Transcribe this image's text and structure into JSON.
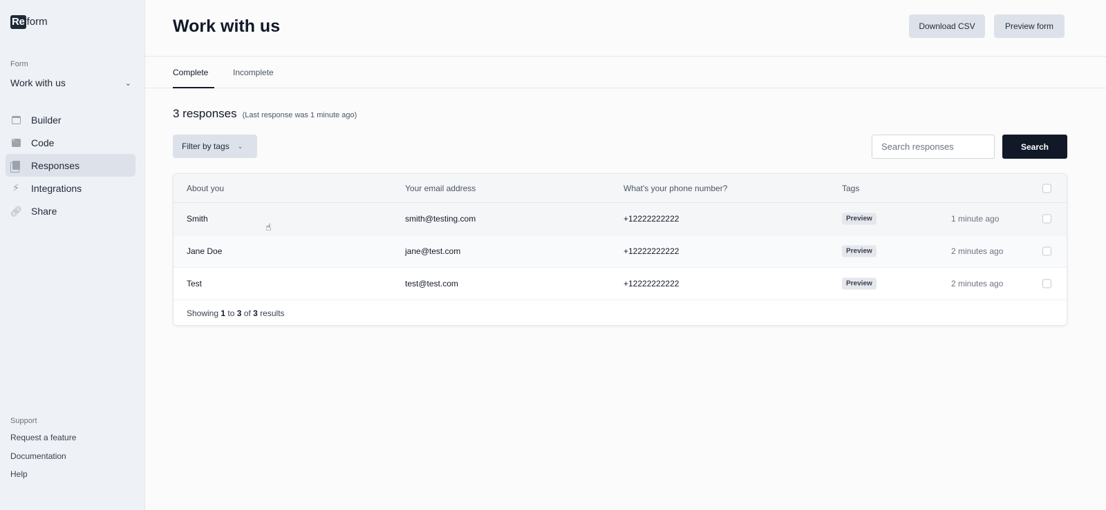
{
  "sidebar": {
    "logo_box": "Re",
    "logo_rest": "form",
    "form_label": "Form",
    "form_value": "Work with us",
    "nav": [
      {
        "label": "Builder",
        "icon": "calendar-icon"
      },
      {
        "label": "Code",
        "icon": "terminal-icon"
      },
      {
        "label": "Responses",
        "icon": "documents-icon",
        "active": true
      },
      {
        "label": "Integrations",
        "icon": "bolt-icon"
      },
      {
        "label": "Share",
        "icon": "link-icon"
      }
    ],
    "support_label": "Support",
    "support_links": [
      "Request a feature",
      "Documentation",
      "Help"
    ]
  },
  "header": {
    "title": "Work with us",
    "download_csv": "Download CSV",
    "preview_form": "Preview form"
  },
  "tabs": {
    "complete": "Complete",
    "incomplete": "Incomplete",
    "active": "complete"
  },
  "responses": {
    "count_text": "3 responses",
    "subtitle": "(Last response was 1 minute ago)",
    "filter_label": "Filter by tags",
    "search_placeholder": "Search responses",
    "search_button": "Search"
  },
  "table": {
    "columns": [
      "About you",
      "Your email address",
      "What's your phone number?",
      "Tags"
    ],
    "rows": [
      {
        "about": "Smith",
        "email": "smith@testing.com",
        "phone": "+12222222222",
        "tag": "Preview",
        "time": "1 minute ago"
      },
      {
        "about": "Jane Doe",
        "email": "jane@test.com",
        "phone": "+12222222222",
        "tag": "Preview",
        "time": "2 minutes ago"
      },
      {
        "about": "Test",
        "email": "test@test.com",
        "phone": "+12222222222",
        "tag": "Preview",
        "time": "2 minutes ago"
      }
    ],
    "footer": {
      "prefix": "Showing",
      "from": "1",
      "to_word": "to",
      "to": "3",
      "of_word": "of",
      "total": "3",
      "suffix": "results"
    }
  },
  "colors": {
    "accent": "#111827",
    "sidebar_bg": "#eef1f5",
    "button_bg": "#dde2ea"
  }
}
